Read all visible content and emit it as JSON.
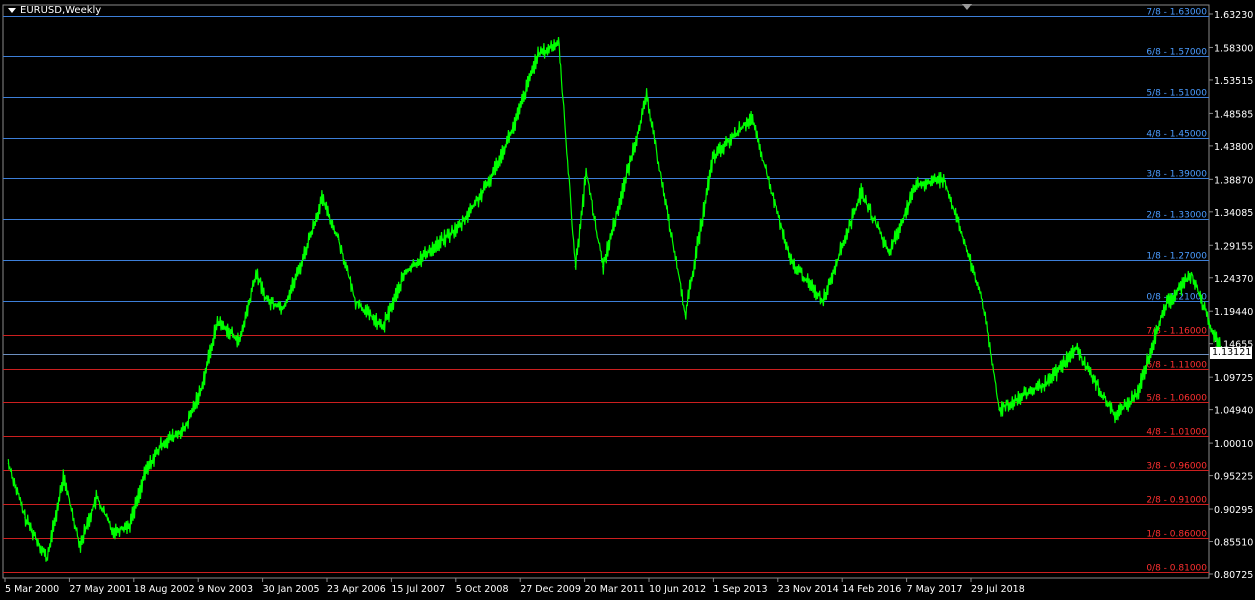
{
  "symbol": "EURUSD,Weekly",
  "current_price": "1.13121",
  "colors": {
    "background": "#000000",
    "price_line": "#00ff00",
    "upper_levels": "#3d7fd9",
    "upper_level_text": "#4b9cff",
    "lower_levels": "#cc1f1f",
    "lower_level_text": "#ff3030",
    "current_price_line": "#6c8fc0",
    "axis_text": "#ffffff"
  },
  "chart_data": {
    "type": "line",
    "title": "EURUSD,Weekly",
    "xlabel": "",
    "ylabel": "",
    "ylim": [
      0.80725,
      1.6323
    ],
    "y_tick_labels": [
      "1.63230",
      "1.58300",
      "1.53515",
      "1.48585",
      "1.43800",
      "1.38870",
      "1.34085",
      "1.29155",
      "1.24370",
      "1.19440",
      "1.14655",
      "1.09725",
      "1.04940",
      "1.00010",
      "0.95225",
      "0.90295",
      "0.85510",
      "0.80725"
    ],
    "x_tick_labels": [
      "5 Mar 2000",
      "27 May 2001",
      "18 Aug 2002",
      "9 Nov 2003",
      "30 Jan 2005",
      "23 Apr 2006",
      "15 Jul 2007",
      "5 Oct 2008",
      "27 Dec 2009",
      "20 Mar 2011",
      "10 Jun 2012",
      "1 Sep 2013",
      "23 Nov 2014",
      "14 Feb 2016",
      "7 May 2017",
      "29 Jul 2018"
    ],
    "murrey_levels_upper": [
      {
        "label": "7/8 - 1.63000",
        "value": 1.63
      },
      {
        "label": "6/8 - 1.57000",
        "value": 1.57
      },
      {
        "label": "5/8 - 1.51000",
        "value": 1.51
      },
      {
        "label": "4/8 - 1.45000",
        "value": 1.45
      },
      {
        "label": "3/8 - 1.39000",
        "value": 1.39
      },
      {
        "label": "2/8 - 1.33000",
        "value": 1.33
      },
      {
        "label": "1/8 - 1.27000",
        "value": 1.27
      },
      {
        "label": "0/8 - 1.21000",
        "value": 1.21
      }
    ],
    "murrey_levels_lower": [
      {
        "label": "7/8 - 1.16000",
        "value": 1.16
      },
      {
        "label": "6/8 - 1.11000",
        "value": 1.11
      },
      {
        "label": "5/8 - 1.06000",
        "value": 1.06
      },
      {
        "label": "4/8 - 1.01000",
        "value": 1.01
      },
      {
        "label": "3/8 - 0.96000",
        "value": 0.96
      },
      {
        "label": "2/8 - 0.91000",
        "value": 0.91
      },
      {
        "label": "1/8 - 0.86000",
        "value": 0.86
      },
      {
        "label": "0/8 - 0.81000",
        "value": 0.81
      }
    ],
    "series": [
      {
        "x": [
          "Mar 2000",
          "Jun 2000",
          "Oct 2000",
          "Jan 2001",
          "Apr 2001",
          "Jul 2001",
          "Oct 2001",
          "Jan 2002",
          "Apr 2002",
          "Jul 2002",
          "Nov 2002",
          "Feb 2003",
          "May 2003",
          "Sep 2003",
          "Dec 2003",
          "Feb 2004",
          "May 2004",
          "Aug 2004",
          "Dec 2004",
          "Mar 2005",
          "Jun 2005",
          "Nov 2005",
          "Mar 2006",
          "Jul 2006",
          "Jan 2007",
          "Jun 2007",
          "Nov 2007",
          "Mar 2008",
          "Jul 2008",
          "Oct 2008",
          "Dec 2008",
          "Mar 2009",
          "Nov 2009",
          "Jun 2010",
          "Nov 2010",
          "Jun 2011",
          "Jan 2012",
          "Jul 2012",
          "Feb 2013",
          "Jul 2013",
          "Dec 2013",
          "May 2014",
          "Dec 2014",
          "Mar 2015",
          "Dec 2015",
          "May 2016",
          "Dec 2016",
          "Apr 2017",
          "Sep 2017",
          "Feb 2018",
          "Jun 2018",
          "Aug 2018"
        ],
        "values": [
          0.97,
          0.89,
          0.83,
          0.95,
          0.85,
          0.92,
          0.87,
          0.88,
          0.96,
          1.0,
          1.02,
          1.08,
          1.18,
          1.15,
          1.25,
          1.21,
          1.2,
          1.26,
          1.36,
          1.3,
          1.21,
          1.17,
          1.25,
          1.28,
          1.32,
          1.38,
          1.47,
          1.57,
          1.59,
          1.26,
          1.4,
          1.26,
          1.51,
          1.19,
          1.42,
          1.48,
          1.27,
          1.21,
          1.37,
          1.28,
          1.38,
          1.39,
          1.21,
          1.05,
          1.09,
          1.14,
          1.04,
          1.07,
          1.2,
          1.25,
          1.16,
          1.13121
        ]
      }
    ]
  }
}
